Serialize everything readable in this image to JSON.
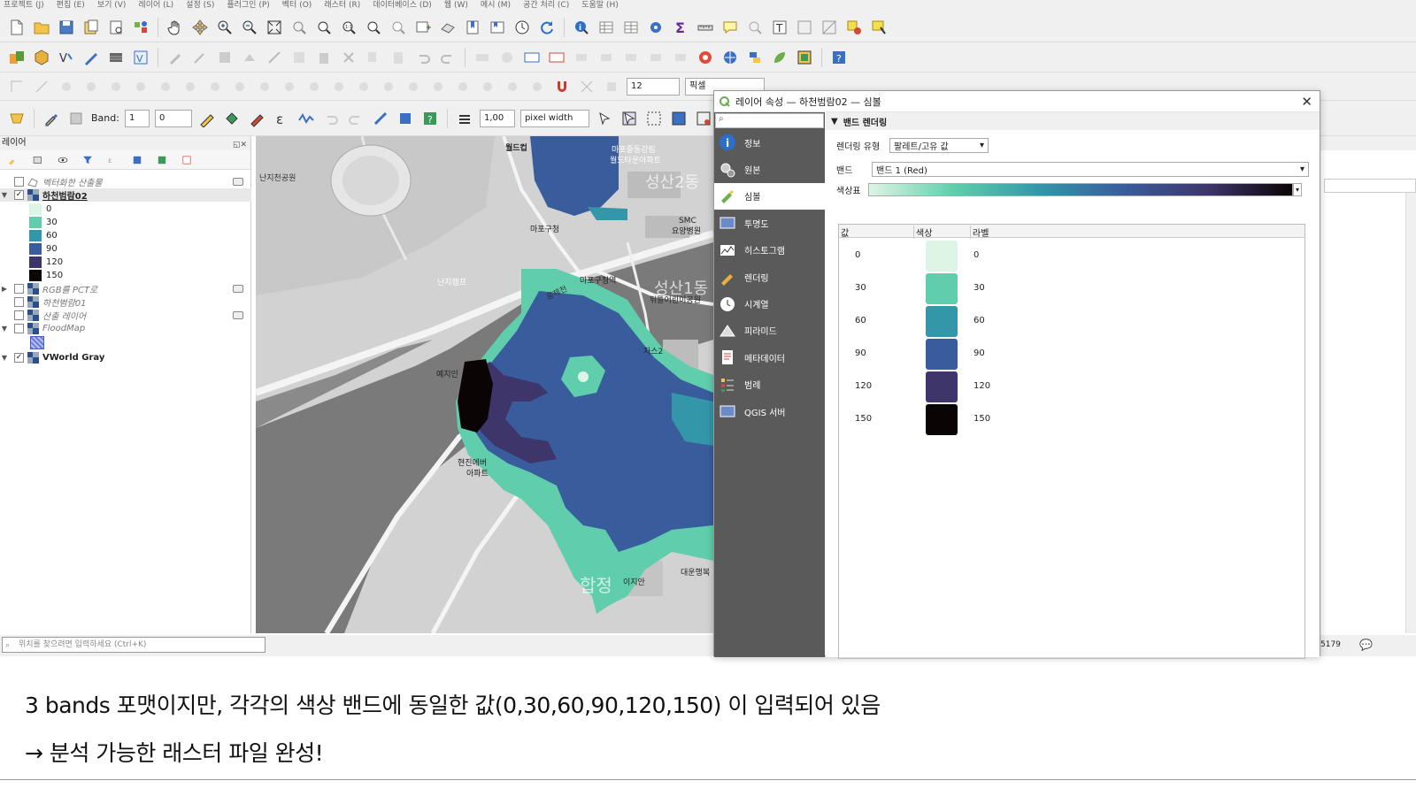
{
  "menu": [
    "프로젝트 (J)",
    "편집 (E)",
    "보기 (V)",
    "레이어 (L)",
    "설정 (S)",
    "플러그인 (P)",
    "벡터 (O)",
    "래스터 (R)",
    "데이터베이스 (D)",
    "웹 (W)",
    "메시 (M)",
    "공간 처리 (C)",
    "도움말 (H)"
  ],
  "toolbar": {
    "font_size_value": "12",
    "unit_value": "픽셀",
    "band_label": "Band:",
    "band_value": "1",
    "value_input": "0",
    "width_value": "1,00",
    "width_unit": "pixel width"
  },
  "layers_panel": {
    "title": "레이어",
    "layers": [
      {
        "name": "벡터화한 산출물",
        "checked": false
      },
      {
        "name": "하천범람02",
        "checked": true
      },
      {
        "name": "RGB를 PCT로",
        "checked": false
      },
      {
        "name": "하천범람01",
        "checked": false
      },
      {
        "name": "산출 레이어",
        "checked": false
      },
      {
        "name": "FloodMap",
        "checked": false
      },
      {
        "name": "VWorld Gray",
        "checked": true
      }
    ],
    "legend": [
      {
        "label": "0",
        "color": "#def5e5"
      },
      {
        "label": "30",
        "color": "#60ceac"
      },
      {
        "label": "60",
        "color": "#3497a9"
      },
      {
        "label": "90",
        "color": "#395d9c"
      },
      {
        "label": "120",
        "color": "#3e356b"
      },
      {
        "label": "150",
        "color": "#0b0405"
      }
    ]
  },
  "map_labels": {
    "l1": "난지천공원",
    "l2": "월드컵",
    "l3": "마포중동강림",
    "l4": "월드타운아파트",
    "l5": "성산2동",
    "l6": "마포구청",
    "l7": "SMC",
    "l8": "요양병원",
    "l9": "홍제천",
    "l10": "마포구청역",
    "l11": "난지캠프",
    "l12": "성산1동",
    "l13": "뒤뜰어린이공원",
    "l14": "예지인",
    "l15": "현진에버",
    "l16": "아파트",
    "l17": "이지안",
    "l18": "대운행복",
    "l19": "합정",
    "l20": "자스2"
  },
  "status": {
    "locator_placeholder": "위치를 찾으려면 입력하세요 (Ctrl+K)",
    "coord_partial": "5179"
  },
  "dialog": {
    "title": "레이어 속성 — 하천범람02 — 심볼",
    "sidebar": [
      {
        "label": "정보",
        "icon": "info-icon"
      },
      {
        "label": "원본",
        "icon": "source-icon"
      },
      {
        "label": "심볼",
        "icon": "symbology-icon"
      },
      {
        "label": "투명도",
        "icon": "transparency-icon"
      },
      {
        "label": "히스토그램",
        "icon": "histogram-icon"
      },
      {
        "label": "렌더링",
        "icon": "rendering-icon"
      },
      {
        "label": "시계열",
        "icon": "temporal-icon"
      },
      {
        "label": "피라미드",
        "icon": "pyramids-icon"
      },
      {
        "label": "메타데이터",
        "icon": "metadata-icon"
      },
      {
        "label": "범례",
        "icon": "legend-icon"
      },
      {
        "label": "QGIS 서버",
        "icon": "qgis-server-icon"
      }
    ],
    "section_title": "밴드 렌더링",
    "render_type_label": "렌더링 유형",
    "render_type_value": "팔레트/고유 값",
    "band_label": "밴드",
    "band_value": "밴드 1 (Red)",
    "ramp_label": "색상표",
    "table_headers": {
      "value": "값",
      "color": "색상",
      "label": "라벨"
    },
    "rows": [
      {
        "value": "0",
        "color": "#def5e5",
        "label": "0"
      },
      {
        "value": "30",
        "color": "#60ceac",
        "label": "30"
      },
      {
        "value": "60",
        "color": "#3497a9",
        "label": "60"
      },
      {
        "value": "90",
        "color": "#395d9c",
        "label": "90"
      },
      {
        "value": "120",
        "color": "#3e356b",
        "label": "120"
      },
      {
        "value": "150",
        "color": "#0b0405",
        "label": "150"
      }
    ]
  },
  "caption": {
    "line1": "3 bands 포맷이지만, 각각의 색상 밴드에 동일한 값(0,30,60,90,120,150) 이 입력되어 있음",
    "line2": "→ 분석 가능한 래스터 파일 완성!"
  }
}
